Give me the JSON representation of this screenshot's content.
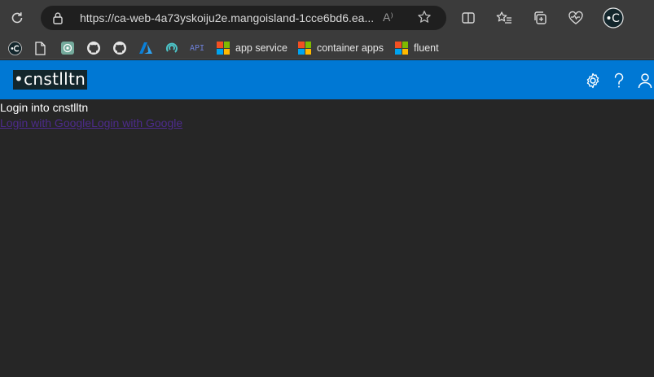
{
  "browser": {
    "url": "https://ca-web-4a73yskoiju2e.mangoisland-1cce6bd6.ea...",
    "read_aloud": "A⁾",
    "profile_initial": "C"
  },
  "bookmarks": [
    {
      "label": "app service"
    },
    {
      "label": "container apps"
    },
    {
      "label": "fluent"
    }
  ],
  "bookmark_api_text": "API",
  "app": {
    "logo": "•cnstlltn"
  },
  "content": {
    "heading": "Login into cnstlltn",
    "links": [
      "Login with Google",
      "Login with Google"
    ]
  },
  "colors": {
    "header_bg": "#0078d4",
    "page_bg": "#262626",
    "link": "#4d2b8c",
    "ms_red": "#f25022",
    "ms_green": "#7fba00",
    "ms_blue": "#00a4ef",
    "ms_yellow": "#ffb900"
  }
}
